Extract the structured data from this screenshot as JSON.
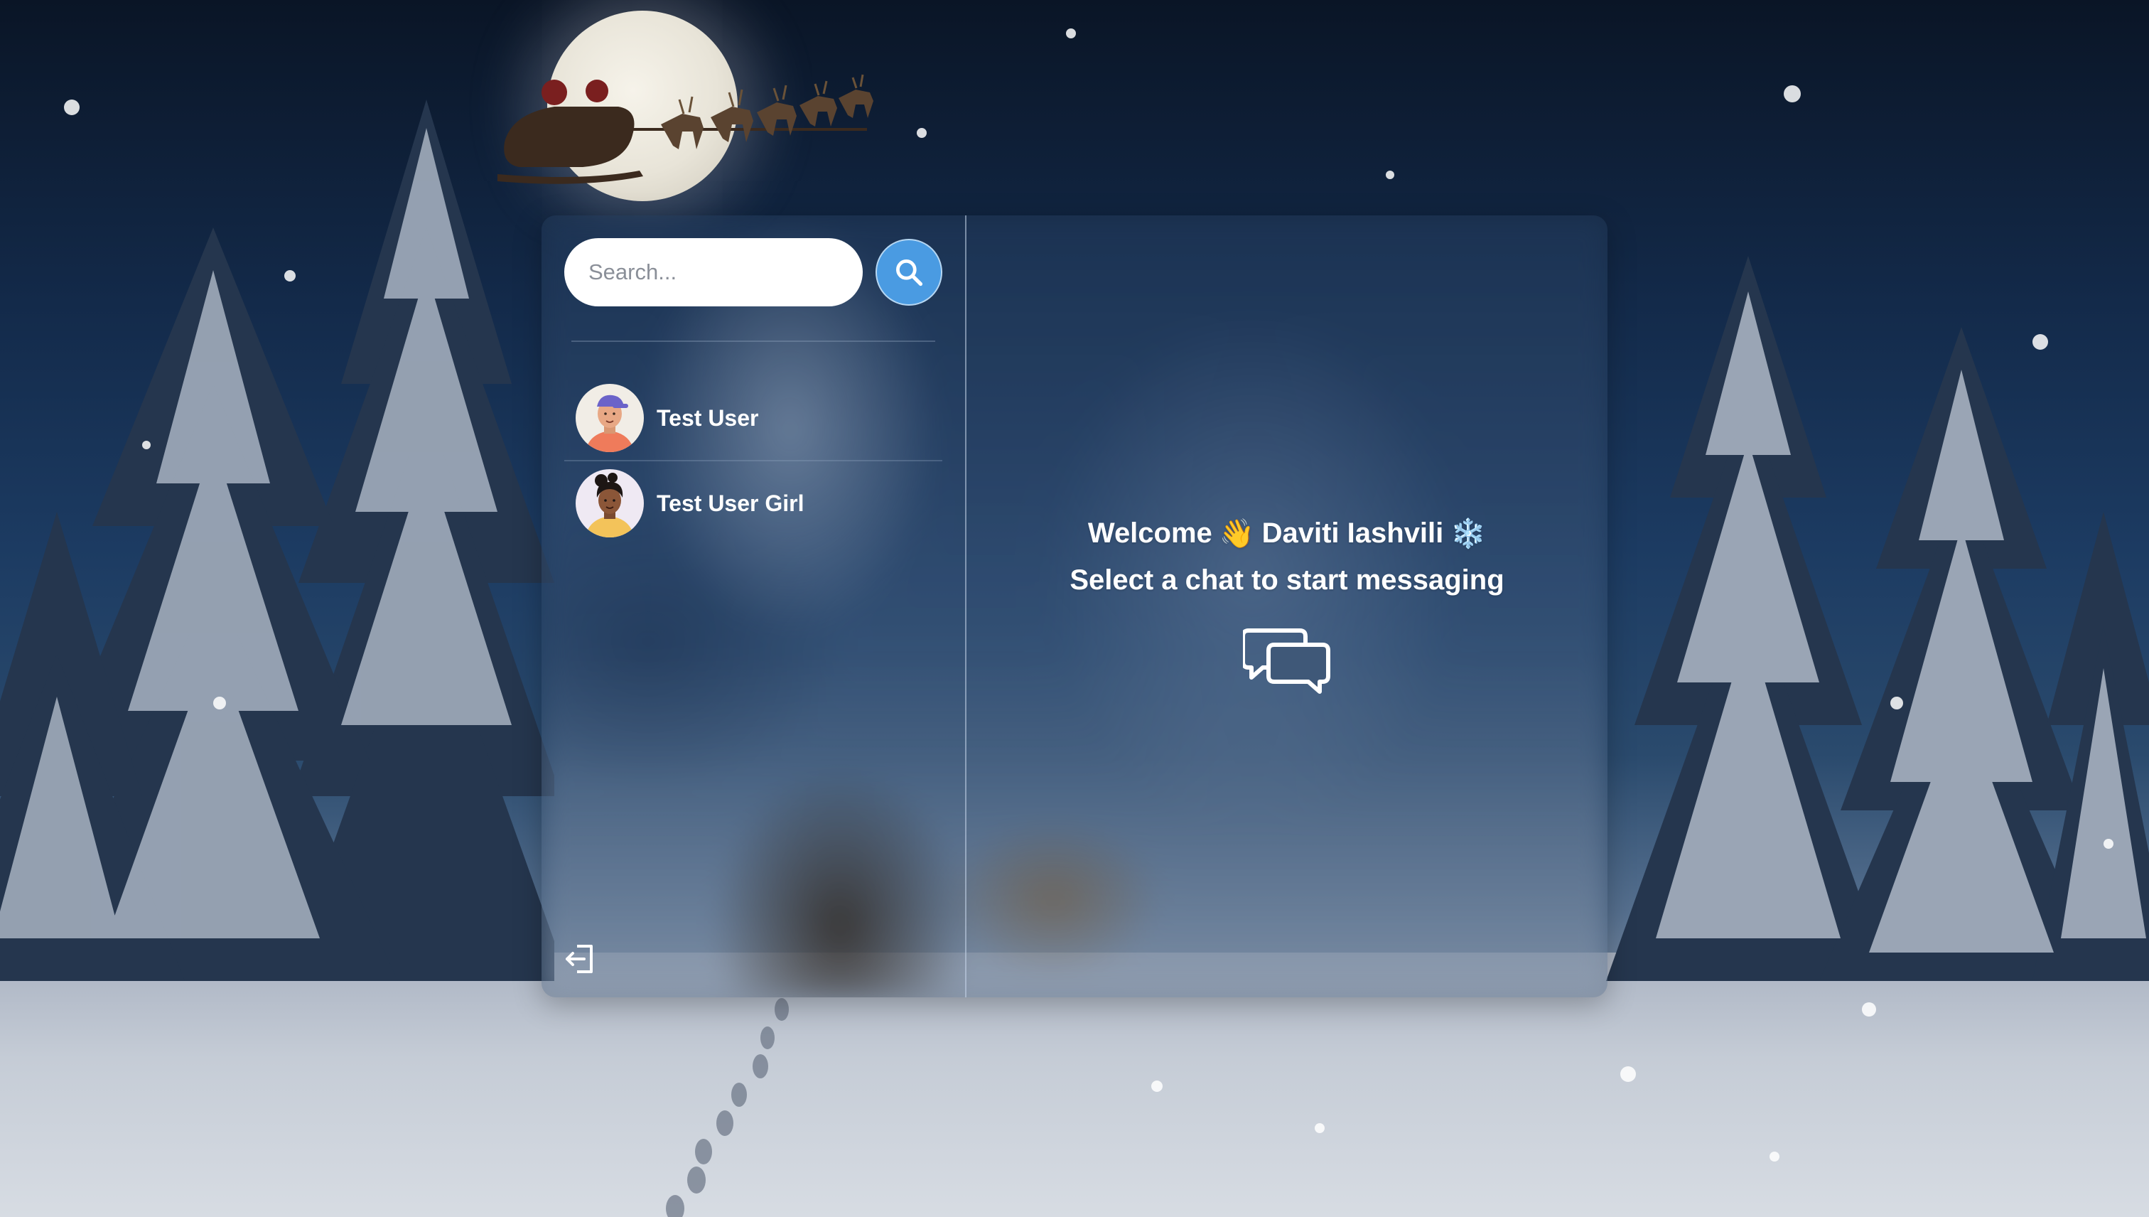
{
  "search": {
    "placeholder": "Search...",
    "button_icon": "search-icon"
  },
  "contacts": [
    {
      "name": "Test User",
      "avatar": "avatar-boy"
    },
    {
      "name": "Test User Girl",
      "avatar": "avatar-girl"
    }
  ],
  "main": {
    "welcome_prefix": "Welcome",
    "wave_emoji": "👋",
    "user_name": "Daviti Iashvili",
    "snow_emoji": "❄️",
    "prompt": "Select a chat to start messaging",
    "chat_icon": "chat-bubbles-icon"
  },
  "sidebar": {
    "logout_icon": "logout-icon"
  },
  "colors": {
    "accent": "#4a9be2",
    "text": "#ffffff"
  }
}
